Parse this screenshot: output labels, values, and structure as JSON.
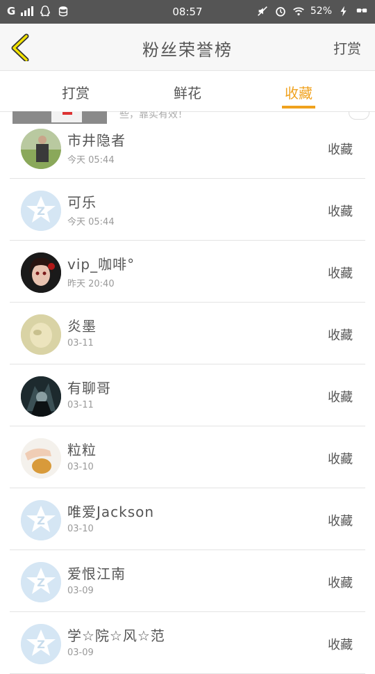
{
  "status_bar": {
    "carrier": "G",
    "time": "08:57",
    "battery": "52%"
  },
  "header": {
    "title": "粉丝荣誉榜",
    "right_action": "打赏",
    "back_icon": "chevron-left-icon",
    "accent_color": "#f0a21e"
  },
  "tabs": [
    {
      "label": "打赏",
      "active": false
    },
    {
      "label": "鲜花",
      "active": false
    },
    {
      "label": "收藏",
      "active": true
    }
  ],
  "peek_text": "些，靠实有效！",
  "rows": [
    {
      "name": "市井隐者",
      "time": "今天 05:44",
      "action": "收藏",
      "avatar": "photo-man-field"
    },
    {
      "name": "可乐",
      "time": "今天 05:44",
      "action": "收藏",
      "avatar": "default-z-icon"
    },
    {
      "name": "vip_咖啡°",
      "time": "昨天 20:40",
      "action": "收藏",
      "avatar": "photo-girl-red"
    },
    {
      "name": "炎墨",
      "time": "03-11",
      "action": "收藏",
      "avatar": "photo-faded"
    },
    {
      "name": "有聊哥",
      "time": "03-11",
      "action": "收藏",
      "avatar": "photo-dark-anime"
    },
    {
      "name": "粒粒",
      "time": "03-10",
      "action": "收藏",
      "avatar": "photo-hand-bread"
    },
    {
      "name": "唯爱Jackson",
      "time": "03-10",
      "action": "收藏",
      "avatar": "default-z-icon"
    },
    {
      "name": "爱恨江南",
      "time": "03-09",
      "action": "收藏",
      "avatar": "default-z-icon"
    },
    {
      "name": "学☆院☆风☆范",
      "time": "03-09",
      "action": "收藏",
      "avatar": "default-z-icon"
    }
  ]
}
